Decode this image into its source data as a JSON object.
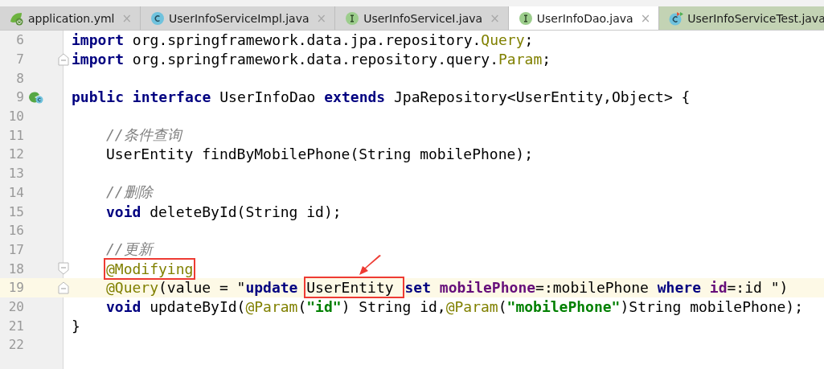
{
  "tabs": [
    {
      "label": "application.yml",
      "kind": "spring",
      "close": "×",
      "selected": false
    },
    {
      "label": "UserInfoServiceImpl.java",
      "kind": "class",
      "close": "×",
      "selected": false
    },
    {
      "label": "UserInfoServiceI.java",
      "kind": "interface",
      "close": "×",
      "selected": false
    },
    {
      "label": "UserInfoDao.java",
      "kind": "interface",
      "close": "×",
      "selected": true
    },
    {
      "label": "UserInfoServiceTest.java",
      "kind": "test",
      "selected": false
    }
  ],
  "lines": [
    {
      "number": "6",
      "kind": "plain",
      "current": false,
      "indented": false,
      "tokens": [
        {
          "t": "import",
          "kind": "keyword"
        },
        {
          "t": " org.springframework.data.jpa.repository.",
          "kind": "plain"
        },
        {
          "t": "Query",
          "kind": "annotation"
        },
        {
          "t": ";",
          "kind": "plain"
        }
      ]
    },
    {
      "number": "7",
      "kind": "fold-end",
      "current": false,
      "indented": false,
      "tokens": [
        {
          "t": "import",
          "kind": "keyword"
        },
        {
          "t": " org.springframework.data.repository.query.",
          "kind": "plain"
        },
        {
          "t": "Param",
          "kind": "annotation"
        },
        {
          "t": ";",
          "kind": "plain"
        }
      ]
    },
    {
      "number": "8",
      "kind": "plain",
      "current": false,
      "indented": false
    },
    {
      "number": "9",
      "kind": "implemented",
      "current": false,
      "indented": false,
      "tokens": [
        {
          "t": "public interface",
          "kind": "keyword"
        },
        {
          "t": " UserInfoDao ",
          "kind": "plain"
        },
        {
          "t": "extends",
          "kind": "keyword"
        },
        {
          "t": " JpaRepository<UserEntity,Object> {",
          "kind": "plain"
        }
      ]
    },
    {
      "number": "10",
      "kind": "plain",
      "current": false,
      "indented": false
    },
    {
      "number": "11",
      "kind": "plain",
      "current": false,
      "indented": true,
      "tokens": [
        {
          "t": "//条件查询",
          "kind": "comment"
        }
      ]
    },
    {
      "number": "12",
      "kind": "plain",
      "current": false,
      "indented": true,
      "tokens": [
        {
          "t": "UserEntity findByMobilePhone(String mobilePhone);",
          "kind": "plain"
        }
      ]
    },
    {
      "number": "13",
      "kind": "plain",
      "current": false,
      "indented": false
    },
    {
      "number": "14",
      "kind": "plain",
      "current": false,
      "indented": true,
      "tokens": [
        {
          "t": "//删除",
          "kind": "comment"
        }
      ]
    },
    {
      "number": "15",
      "kind": "plain",
      "current": false,
      "indented": true,
      "tokens": [
        {
          "t": "void",
          "kind": "keyword"
        },
        {
          "t": " deleteById(String id);",
          "kind": "plain"
        }
      ]
    },
    {
      "number": "16",
      "kind": "plain",
      "current": false,
      "indented": false
    },
    {
      "number": "17",
      "kind": "plain",
      "current": false,
      "indented": true,
      "tokens": [
        {
          "t": "//更新",
          "kind": "comment"
        }
      ]
    },
    {
      "number": "18",
      "kind": "fold-start",
      "current": false,
      "indented": true,
      "tokens": [
        {
          "t": "@Modifying",
          "kind": "annotation",
          "box": {
            "kind": "plain"
          }
        }
      ]
    },
    {
      "number": "19",
      "kind": "fold-end",
      "current": true,
      "indented": true,
      "tokens": [
        {
          "t": "@Query",
          "kind": "annotation"
        },
        {
          "t": "(value = \"",
          "kind": "plain"
        },
        {
          "t": "update ",
          "kind": "keyword"
        },
        {
          "t": "UserEntity ",
          "kind": "plain",
          "box": {
            "kind": "arrow"
          }
        },
        {
          "t": "set ",
          "kind": "keyword"
        },
        {
          "t": "mobilePhone",
          "kind": "field"
        },
        {
          "t": "=:mobilePhone ",
          "kind": "plain"
        },
        {
          "t": "where ",
          "kind": "keyword"
        },
        {
          "t": "id",
          "kind": "field"
        },
        {
          "t": "=:id \")",
          "kind": "plain"
        }
      ]
    },
    {
      "number": "20",
      "kind": "plain",
      "current": false,
      "indented": true,
      "tokens": [
        {
          "t": "void",
          "kind": "keyword"
        },
        {
          "t": " updateById(",
          "kind": "plain"
        },
        {
          "t": "@Param",
          "kind": "annotation"
        },
        {
          "t": "(",
          "kind": "plain"
        },
        {
          "t": "\"id\"",
          "kind": "string"
        },
        {
          "t": ") String id,",
          "kind": "plain"
        },
        {
          "t": "@Param",
          "kind": "annotation"
        },
        {
          "t": "(",
          "kind": "plain"
        },
        {
          "t": "\"mobilePhone\"",
          "kind": "string"
        },
        {
          "t": ")String mobilePhone);",
          "kind": "plain"
        }
      ]
    },
    {
      "number": "21",
      "kind": "plain",
      "current": false,
      "indented": false,
      "tokens": [
        {
          "t": "}",
          "kind": "plain"
        }
      ]
    },
    {
      "number": "22",
      "kind": "plain",
      "current": false,
      "indented": false
    }
  ]
}
